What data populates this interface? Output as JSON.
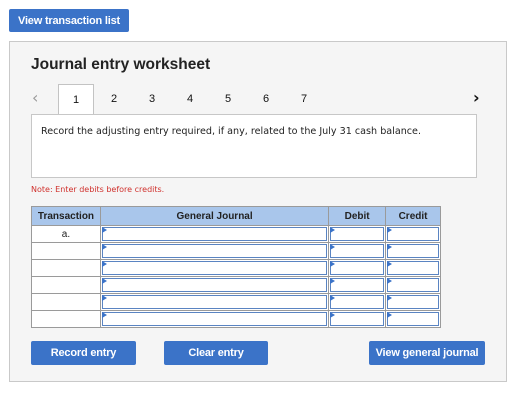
{
  "top": {
    "view_transaction_list": "View transaction list"
  },
  "worksheet": {
    "title": "Journal entry worksheet",
    "tabs": [
      "1",
      "2",
      "3",
      "4",
      "5",
      "6",
      "7"
    ],
    "active_tab": "1",
    "prev_icon": "chevron-left-icon",
    "next_icon": "chevron-right-icon",
    "prompt": "Record the adjusting entry required, if any, related to the July 31 cash balance.",
    "note": "Note: Enter debits before credits."
  },
  "table": {
    "headers": {
      "transaction": "Transaction",
      "general_journal": "General Journal",
      "debit": "Debit",
      "credit": "Credit"
    },
    "rows": [
      {
        "transaction": "a."
      },
      {
        "transaction": ""
      },
      {
        "transaction": ""
      },
      {
        "transaction": ""
      },
      {
        "transaction": ""
      },
      {
        "transaction": ""
      }
    ]
  },
  "buttons": {
    "record_entry": "Record entry",
    "clear_entry": "Clear entry",
    "view_general_journal": "View general journal"
  },
  "colors": {
    "accent": "#3b73c8",
    "header_bg": "#a9c6eb",
    "note_red": "#d0312d",
    "panel_bg": "#f5f5f5"
  }
}
